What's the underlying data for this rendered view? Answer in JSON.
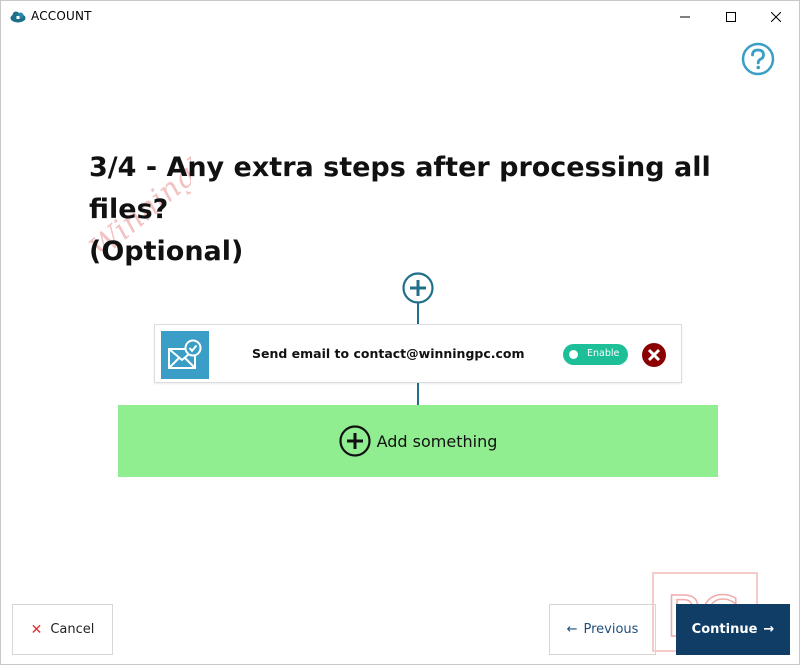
{
  "window": {
    "title": "ACCOUNT"
  },
  "heading": {
    "line1": "3/4 - Any extra steps after processing all files?",
    "line2": "(Optional)"
  },
  "watermark": {
    "text": "WinningPC"
  },
  "steps": [
    {
      "label": "Send email to contact@winningpc.com",
      "icon": "email-check-icon",
      "toggle_label": "Enable",
      "enabled": true
    }
  ],
  "add_something": {
    "label": "Add something"
  },
  "footer": {
    "cancel_label": "Cancel",
    "previous_label": "Previous",
    "continue_label": "Continue"
  },
  "logo": {
    "text": "PC"
  },
  "colors": {
    "accent": "#1f6f8b",
    "step_icon_bg": "#3a9ec7",
    "toggle_on": "#1dbf99",
    "remove": "#8b0000",
    "add_area": "#90ee90",
    "continue_bg": "#0f3d66",
    "cancel_x": "#e03030"
  }
}
